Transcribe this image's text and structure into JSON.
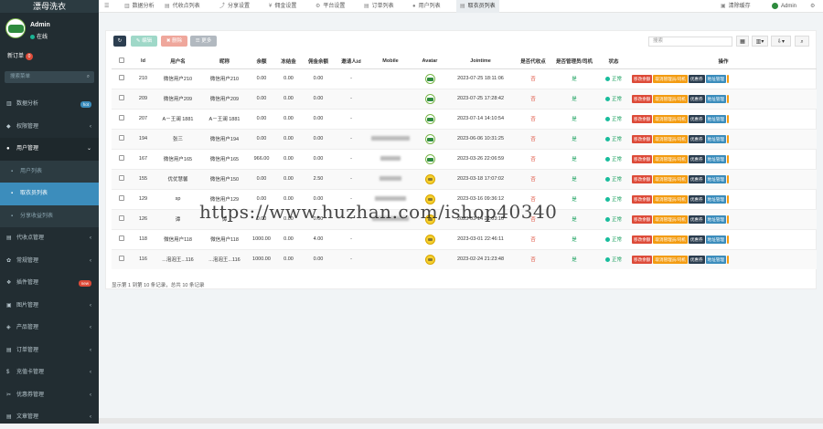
{
  "sidebar": {
    "brand": "漂母洗衣",
    "user_name": "Admin",
    "user_status": "在线",
    "new_order_label": "新订单",
    "new_order_count": "0",
    "search_placeholder": "搜索菜单",
    "items": [
      {
        "label": "数据分析",
        "badge": "hot",
        "badge_color": "#3c8dbc"
      },
      {
        "label": "权限管理"
      },
      {
        "label": "用户管理",
        "open": true
      },
      {
        "label": "用户列表",
        "sub": true
      },
      {
        "label": "取衣员列表",
        "sub": true,
        "active": true
      },
      {
        "label": "分享收益列表",
        "sub": true
      },
      {
        "label": "代收点管理"
      },
      {
        "label": "常规管理"
      },
      {
        "label": "插件管理",
        "badge": "new",
        "badge_color": "#dd4b39"
      },
      {
        "label": "图片管理"
      },
      {
        "label": "产品管理"
      },
      {
        "label": "订单管理"
      },
      {
        "label": "充值卡管理"
      },
      {
        "label": "优惠券管理"
      },
      {
        "label": "文章管理"
      }
    ]
  },
  "topbar": {
    "tabs": [
      {
        "label": "数据分析",
        "icon": "chart-icon"
      },
      {
        "label": "代收点列表",
        "icon": "list-icon"
      },
      {
        "label": "分享设置",
        "icon": "share-icon"
      },
      {
        "label": "佣金设置",
        "icon": "money-icon"
      },
      {
        "label": "平台设置",
        "icon": "settings-icon"
      },
      {
        "label": "订单列表",
        "icon": "order-icon"
      },
      {
        "label": "用户列表",
        "icon": "user-icon"
      },
      {
        "label": "取衣员列表",
        "icon": "list-icon",
        "active": true
      }
    ],
    "clear_cache": "清除缓存",
    "admin": "Admin"
  },
  "toolbar": {
    "edit": "编辑",
    "delete": "删除",
    "more": "更多",
    "search_placeholder": "搜索"
  },
  "table": {
    "headers": [
      "Id",
      "用户名",
      "昵称",
      "余额",
      "冻结金",
      "佣金余额",
      "邀请人id",
      "Mobile",
      "Avatar",
      "Jointime",
      "是否代收点",
      "是否管理员/司机",
      "状态",
      "操作"
    ],
    "rows": [
      {
        "id": "210",
        "username": "微信用户210",
        "nickname": "微信用户210",
        "balance": "0.00",
        "frozen": "0.00",
        "commission": "0.00",
        "inviter": "-",
        "mobile": "",
        "avatar": "green",
        "jointime": "2023-07-25 18:11:06",
        "agent": "否",
        "admin": "是",
        "status": "正常"
      },
      {
        "id": "209",
        "username": "微信用户209",
        "nickname": "微信用户209",
        "balance": "0.00",
        "frozen": "0.00",
        "commission": "0.00",
        "inviter": "-",
        "mobile": "",
        "avatar": "green",
        "jointime": "2023-07-25 17:28:42",
        "agent": "否",
        "admin": "是",
        "status": "正常"
      },
      {
        "id": "207",
        "username": "A－王澜 1881",
        "nickname": "A－王澜 1881",
        "balance": "0.00",
        "frozen": "0.00",
        "commission": "0.00",
        "inviter": "-",
        "mobile": "",
        "avatar": "green",
        "jointime": "2023-07-14 14:10:54",
        "agent": "否",
        "admin": "是",
        "status": "正常"
      },
      {
        "id": "194",
        "username": "张三",
        "nickname": "微信用户194",
        "balance": "0.00",
        "frozen": "0.00",
        "commission": "0.00",
        "inviter": "-",
        "mobile": "blur",
        "avatar": "green",
        "jointime": "2023-06-06 10:31:25",
        "agent": "否",
        "admin": "是",
        "status": "正常"
      },
      {
        "id": "167",
        "username": "微信用户165",
        "nickname": "微信用户165",
        "balance": "966.00",
        "frozen": "0.00",
        "commission": "0.00",
        "inviter": "-",
        "mobile": "blur",
        "avatar": "green",
        "jointime": "2023-03-26 22:06:59",
        "agent": "否",
        "admin": "是",
        "status": "正常"
      },
      {
        "id": "155",
        "username": "优优慧馨",
        "nickname": "微信用户150",
        "balance": "0.00",
        "frozen": "0.00",
        "commission": "2.50",
        "inviter": "-",
        "mobile": "blur",
        "avatar": "yellow",
        "jointime": "2023-03-18 17:07:02",
        "agent": "否",
        "admin": "是",
        "status": "正常"
      },
      {
        "id": "129",
        "username": "sp",
        "nickname": "微信用户129",
        "balance": "0.00",
        "frozen": "0.00",
        "commission": "0.00",
        "inviter": "-",
        "mobile": "blur",
        "avatar": "yellow",
        "jointime": "2023-03-16 09:36:12",
        "agent": "否",
        "admin": "是",
        "status": "正常"
      },
      {
        "id": "126",
        "username": "谭",
        "nickname": "谭",
        "balance": "0.00",
        "frozen": "0.00",
        "commission": "0.00",
        "inviter": "-",
        "mobile": "blur",
        "avatar": "yellow",
        "jointime": "2023-03-14 21:03:10",
        "agent": "否",
        "admin": "是",
        "status": "正常"
      },
      {
        "id": "118",
        "username": "微信用户118",
        "nickname": "微信用户118",
        "balance": "1000.00",
        "frozen": "0.00",
        "commission": "4.00",
        "inviter": "-",
        "mobile": "",
        "avatar": "yellow",
        "jointime": "2023-03-01 22:46:11",
        "agent": "否",
        "admin": "是",
        "status": "正常"
      },
      {
        "id": "116",
        "username": "...泡泡王...116",
        "nickname": "...泡泡王...116",
        "balance": "1000.00",
        "frozen": "0.00",
        "commission": "0.00",
        "inviter": "-",
        "mobile": "",
        "avatar": "yellow",
        "jointime": "2023-02-24 21:23:48",
        "agent": "否",
        "admin": "是",
        "status": "正常"
      }
    ],
    "row_actions": [
      {
        "label": "移改余额",
        "color": "#dd4b39"
      },
      {
        "label": "取消管理员/司机",
        "color": "#f39c12"
      },
      {
        "label": "优惠券",
        "color": "#2c3e50"
      },
      {
        "label": "地址管理",
        "color": "#3c8dbc"
      }
    ]
  },
  "footer": "显示第 1 到第 10 条记录，总共 10 条记录",
  "watermark": "https://www.huzhan.com/ishop40340"
}
